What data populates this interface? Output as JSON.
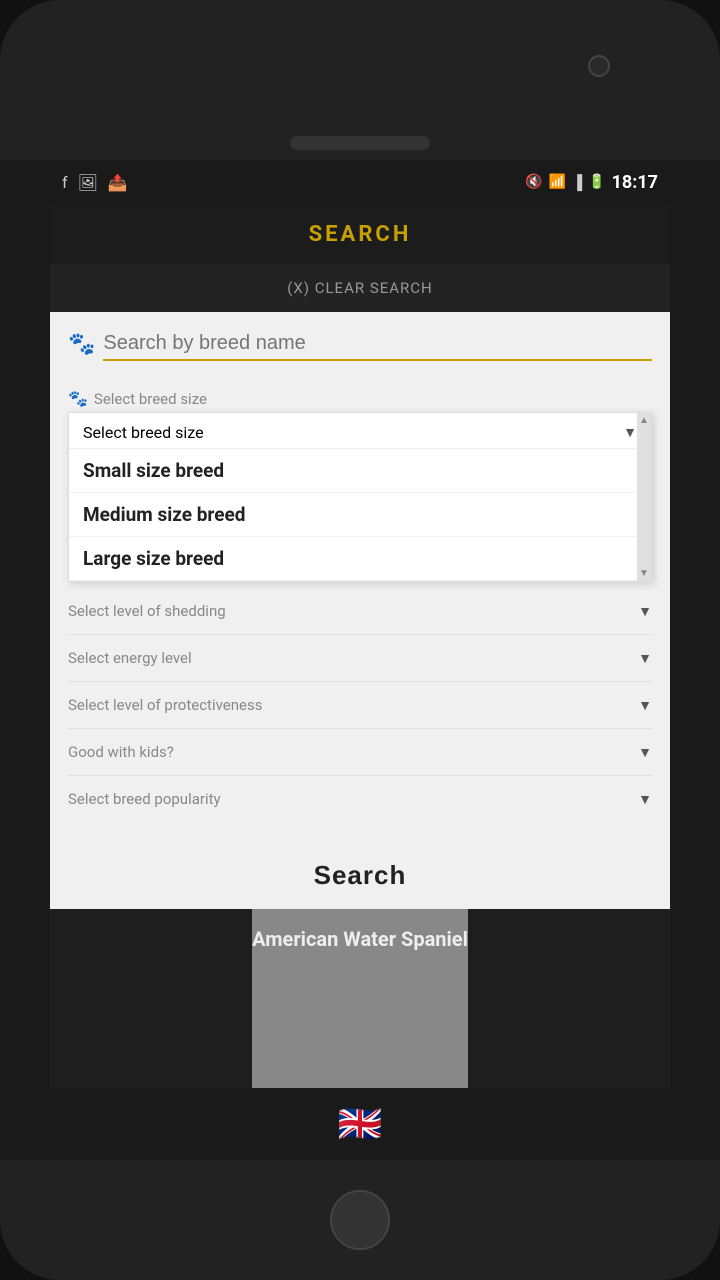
{
  "status_bar": {
    "time": "18:17",
    "icons_left": [
      "facebook-icon",
      "gallery-icon",
      "share-icon"
    ],
    "icons_right": [
      "mute-icon",
      "wifi-icon",
      "signal-icon",
      "battery-icon"
    ]
  },
  "app_header": {
    "title": "SEARCH"
  },
  "clear_search": {
    "label": "(X) CLEAR SEARCH"
  },
  "search_dialog": {
    "search_input": {
      "placeholder": "Search by breed name",
      "value": ""
    },
    "breed_size_dropdown": {
      "label": "Select breed size",
      "options": [
        "Small size breed",
        "Medium size breed",
        "Large size breed"
      ]
    },
    "shedding_dropdown": {
      "label": "Select level of shedding"
    },
    "energy_dropdown": {
      "label": "Select energy level"
    },
    "protectiveness_dropdown": {
      "label": "Select level of protectiveness"
    },
    "kids_dropdown": {
      "label": "Good with kids?"
    },
    "popularity_dropdown": {
      "label": "Select breed popularity"
    },
    "search_button": {
      "label": "Search"
    }
  },
  "breed_display": {
    "name": "American Water Spaniel"
  },
  "bottom_bar": {
    "flag": "🇬🇧"
  }
}
